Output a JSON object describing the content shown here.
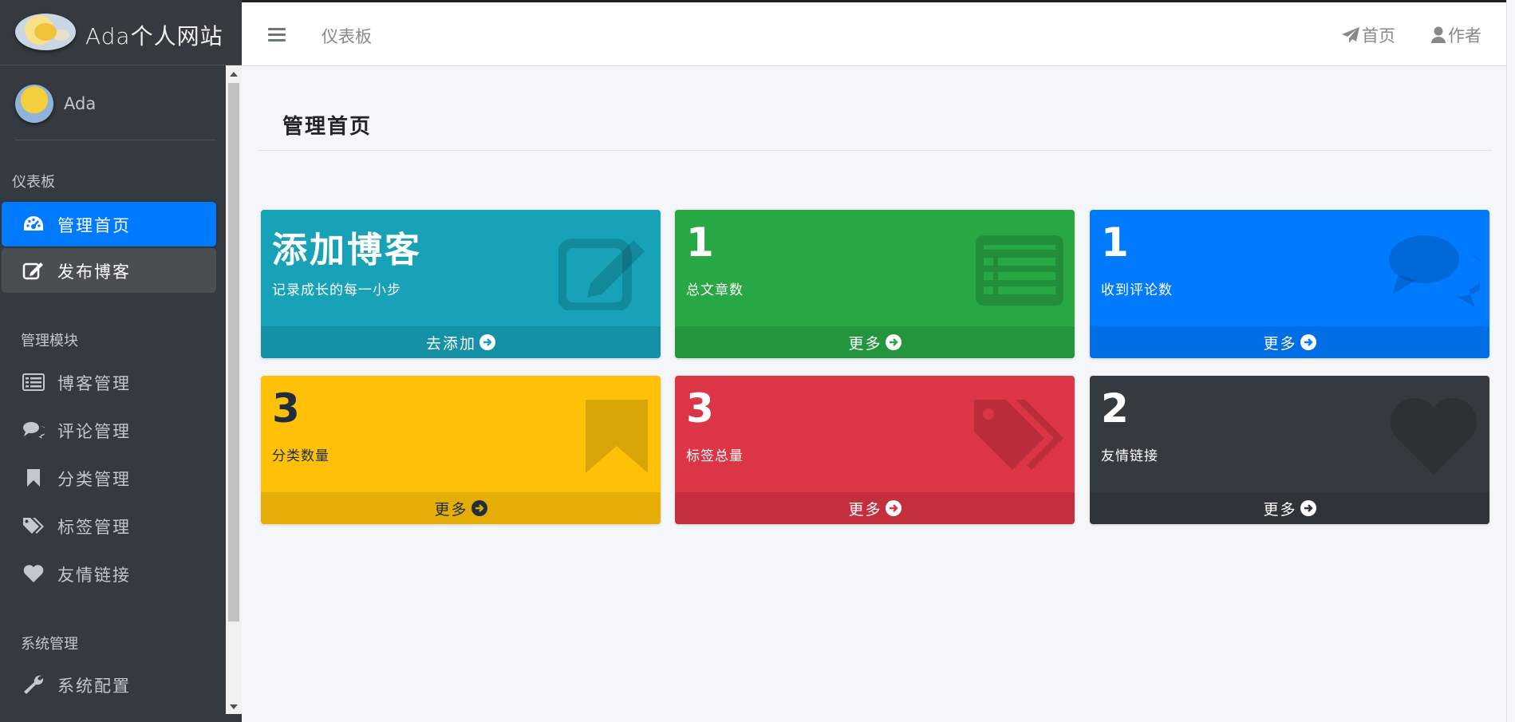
{
  "brand": {
    "title": "Ada个人网站"
  },
  "user": {
    "name": "Ada"
  },
  "sidebar": {
    "sections": [
      {
        "header": "仪表板",
        "items": [
          {
            "label": "管理首页",
            "icon": "dashboard-icon",
            "state": "active"
          },
          {
            "label": "发布博客",
            "icon": "edit-icon",
            "state": "hover"
          }
        ]
      },
      {
        "header": "管理模块",
        "items": [
          {
            "label": "博客管理",
            "icon": "list-icon"
          },
          {
            "label": "评论管理",
            "icon": "comments-icon"
          },
          {
            "label": "分类管理",
            "icon": "bookmark-icon"
          },
          {
            "label": "标签管理",
            "icon": "tags-icon"
          },
          {
            "label": "友情链接",
            "icon": "heart-icon"
          }
        ]
      },
      {
        "header": "系统管理",
        "items": [
          {
            "label": "系统配置",
            "icon": "wrench-icon"
          }
        ]
      }
    ]
  },
  "topbar": {
    "breadcrumb": "仪表板",
    "links": [
      {
        "label": "首页",
        "icon": "paper-plane-icon"
      },
      {
        "label": "作者",
        "icon": "user-icon"
      }
    ]
  },
  "content": {
    "title": "管理首页",
    "boxes": [
      {
        "value": "添加博客",
        "desc": "记录成长的每一小步",
        "footer": "去添加",
        "icon": "edit-icon",
        "color": "#17a2b8",
        "text_color": "#ffffff"
      },
      {
        "value": "1",
        "desc": "总文章数",
        "footer": "更多",
        "icon": "list-alt-icon",
        "color": "#28a745",
        "text_color": "#ffffff"
      },
      {
        "value": "1",
        "desc": "收到评论数",
        "footer": "更多",
        "icon": "comments-icon",
        "color": "#007bff",
        "text_color": "#ffffff"
      },
      {
        "value": "3",
        "desc": "分类数量",
        "footer": "更多",
        "icon": "bookmark-icon",
        "color": "#ffc107",
        "text_color": "#1f2d3d"
      },
      {
        "value": "3",
        "desc": "标签总量",
        "footer": "更多",
        "icon": "tags-icon",
        "color": "#dc3545",
        "text_color": "#ffffff"
      },
      {
        "value": "2",
        "desc": "友情链接",
        "footer": "更多",
        "icon": "heart-icon",
        "color": "#343a40",
        "text_color": "#ffffff"
      }
    ]
  }
}
